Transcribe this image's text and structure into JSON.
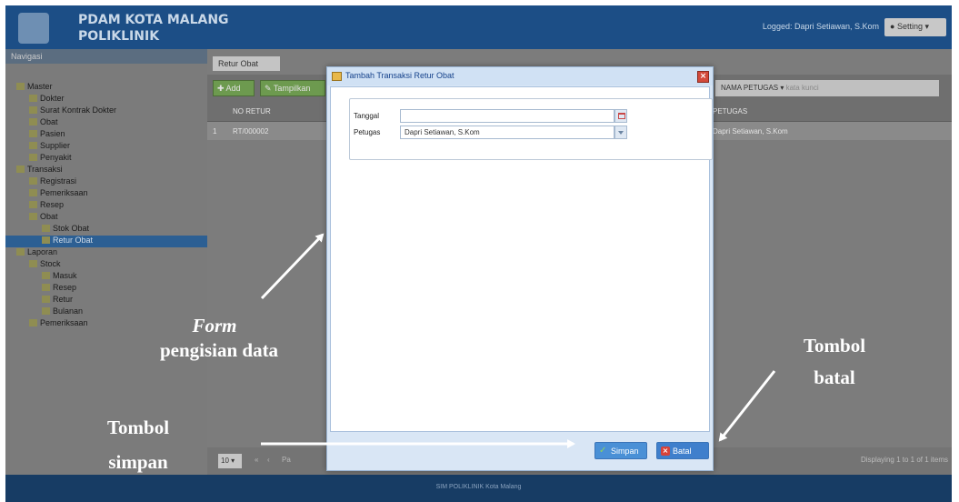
{
  "header": {
    "brand_line1": "PDAM KOTA MALANG",
    "brand_line2": "POLIKLINIK",
    "logged_text": "Logged: Dapri Setiawan, S.Kom",
    "setting_label": "Setting"
  },
  "sidebar": {
    "title": "Navigasi",
    "items": [
      {
        "label": "Master",
        "level": 0,
        "folder": true
      },
      {
        "label": "Dokter",
        "level": 1
      },
      {
        "label": "Surat Kontrak Dokter",
        "level": 1
      },
      {
        "label": "Obat",
        "level": 1
      },
      {
        "label": "Pasien",
        "level": 1
      },
      {
        "label": "Supplier",
        "level": 1
      },
      {
        "label": "Penyakit",
        "level": 1
      },
      {
        "label": "Transaksi",
        "level": 0,
        "folder": true
      },
      {
        "label": "Registrasi",
        "level": 1
      },
      {
        "label": "Pemeriksaan",
        "level": 1
      },
      {
        "label": "Resep",
        "level": 1
      },
      {
        "label": "Obat",
        "level": 1,
        "folder": true
      },
      {
        "label": "Stok Obat",
        "level": 2
      },
      {
        "label": "Retur Obat",
        "level": 2,
        "selected": true
      },
      {
        "label": "Laporan",
        "level": 0,
        "folder": true
      },
      {
        "label": "Stock",
        "level": 1,
        "folder": true
      },
      {
        "label": "Masuk",
        "level": 2
      },
      {
        "label": "Resep",
        "level": 2
      },
      {
        "label": "Retur",
        "level": 2
      },
      {
        "label": "Bulanan",
        "level": 2
      },
      {
        "label": "Pemeriksaan",
        "level": 1
      }
    ]
  },
  "main": {
    "tab_label": "Retur Obat",
    "add_label": "Add",
    "second_btn_label": "Tampilkan",
    "filter_label": "NAMA PETUGAS",
    "filter_placeholder": "kata kunci",
    "col_no_retur": "NO RETUR",
    "col_petugas": "PETUGAS",
    "row_index": "1",
    "row_no_retur": "RT/000002",
    "row_petugas": "Dapri Setiawan, S.Kom",
    "page_size": "10",
    "pager_text": "Pa",
    "display_info": "Displaying 1 to 1 of 1 items"
  },
  "modal": {
    "title": "Tambah Transaksi Retur Obat",
    "tanggal_label": "Tanggal",
    "tanggal_value": "",
    "petugas_label": "Petugas",
    "petugas_value": "Dapri Setiawan, S.Kom",
    "simpan_label": "Simpan",
    "batal_label": "Batal"
  },
  "footer": {
    "text": "SIM POLIKLINIK Kota Malang"
  },
  "annotations": {
    "form_word": "Form",
    "form_rest": "pengisian data",
    "tombol_batal_1": "Tombol",
    "tombol_batal_2": "batal",
    "tombol_simpan_1": "Tombol",
    "tombol_simpan_2": "simpan"
  },
  "colors": {
    "header_bg": "#1c4e86",
    "modal_bg": "#d9e6f5",
    "button_blue": "#4a90d6",
    "annotation_arrow": "#ffffff"
  }
}
